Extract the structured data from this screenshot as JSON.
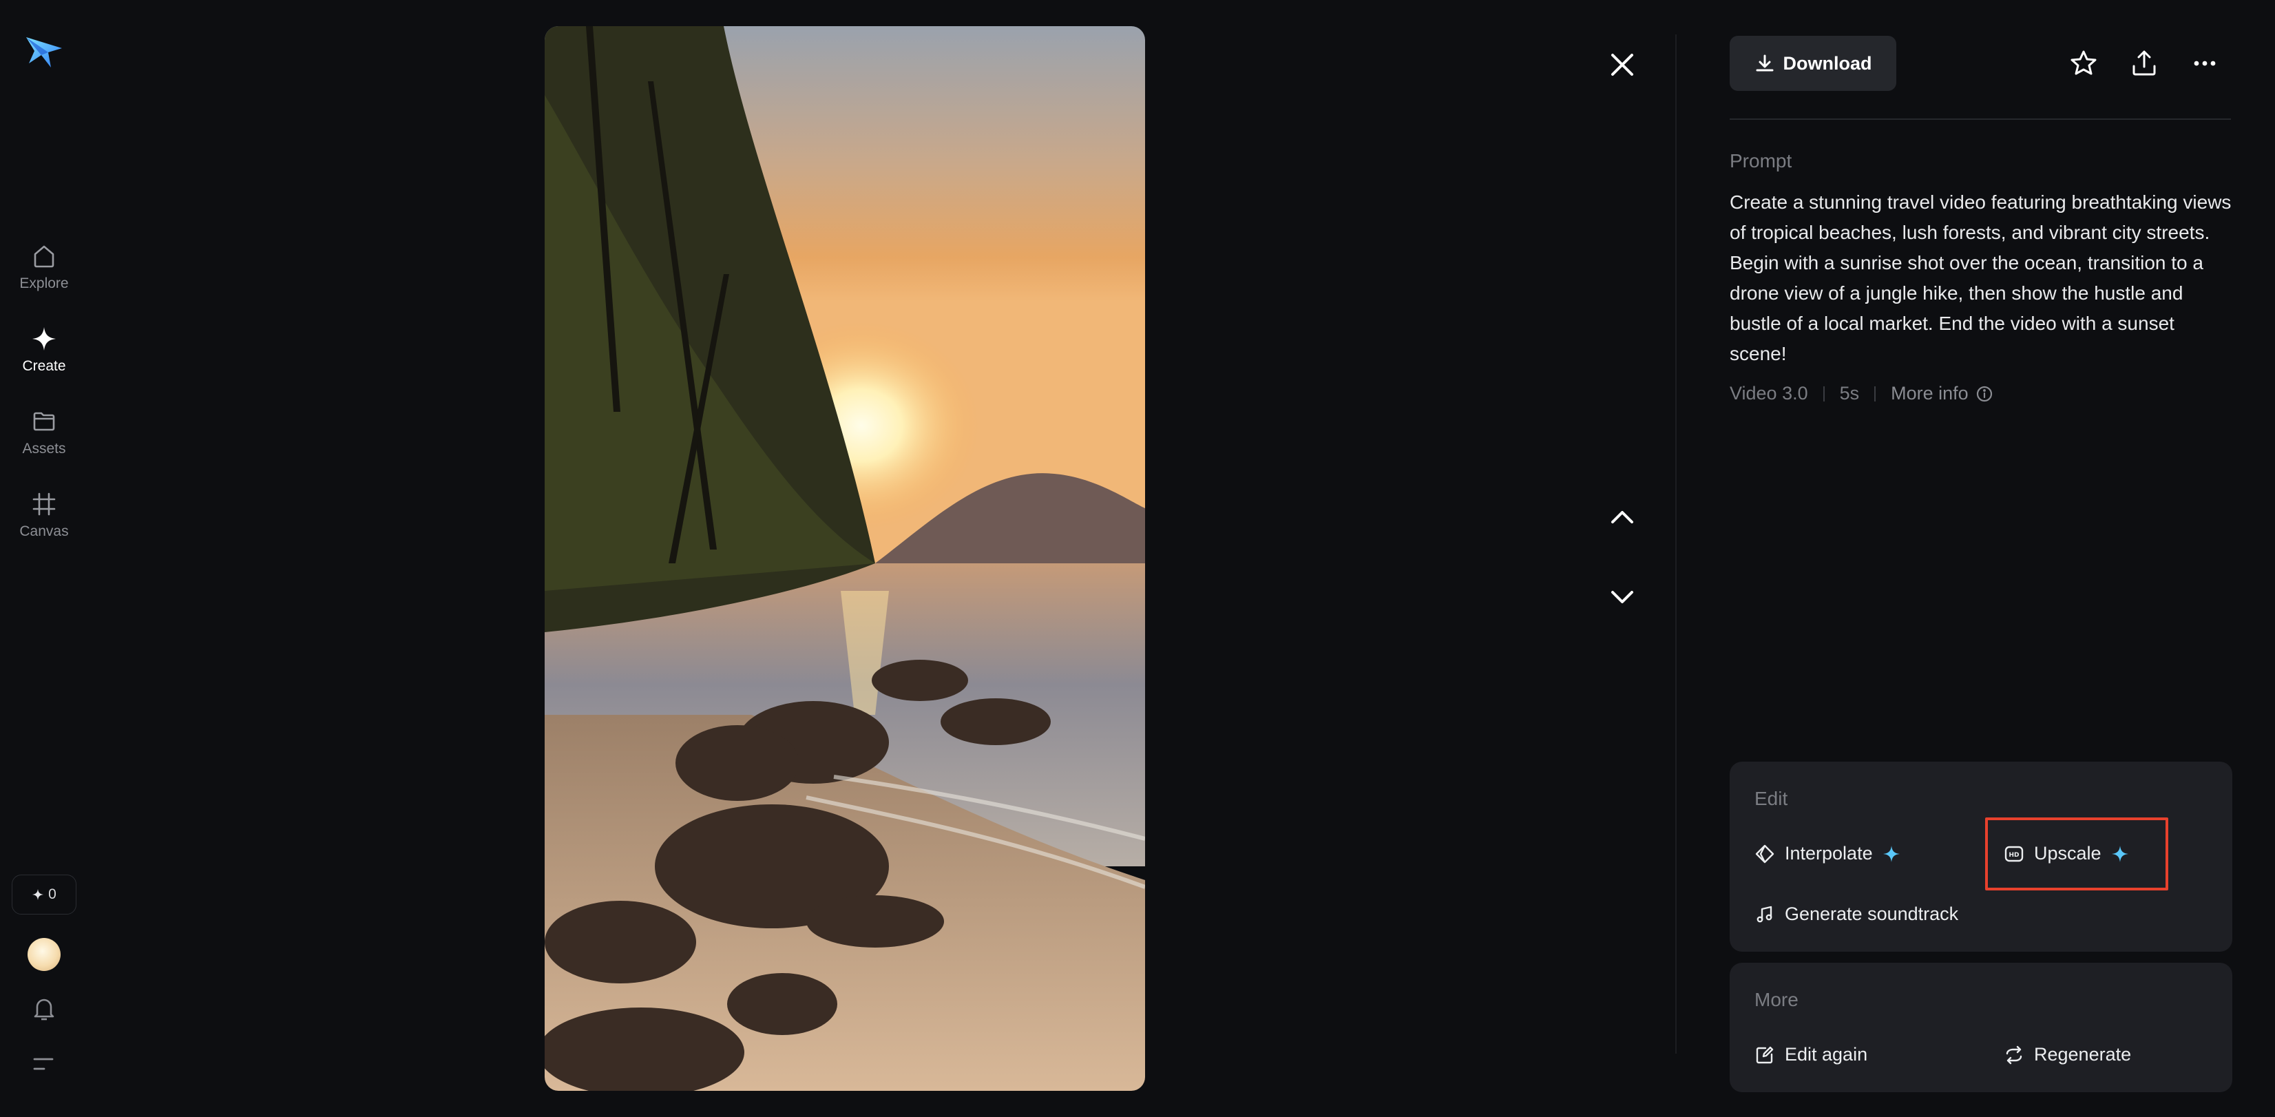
{
  "sidebar": {
    "items": [
      {
        "label": "Explore",
        "icon": "home-icon",
        "active": false
      },
      {
        "label": "Create",
        "icon": "sparkle-icon",
        "active": true
      },
      {
        "label": "Assets",
        "icon": "folder-icon",
        "active": false
      },
      {
        "label": "Canvas",
        "icon": "canvas-icon",
        "active": false
      }
    ],
    "credits": "0",
    "credits_icon": "sparkle-icon"
  },
  "media": {
    "type": "video",
    "description_icon": "beach-sunset-video"
  },
  "toolbar": {
    "download_label": "Download",
    "icons": [
      "star-icon",
      "share-icon",
      "more-icon"
    ]
  },
  "prompt": {
    "label": "Prompt",
    "text": "Create a stunning travel video featuring breathtaking views of tropical beaches, lush forests, and vibrant city streets. Begin with a sunrise shot over the ocean, transition to a drone view of a jungle hike, then show the hustle and bustle of a local market. End the video with a sunset scene!"
  },
  "meta": {
    "model": "Video 3.0",
    "duration": "5s",
    "more_info": "More info"
  },
  "edit": {
    "title": "Edit",
    "interpolate": "Interpolate",
    "upscale": "Upscale",
    "soundtrack": "Generate soundtrack"
  },
  "more": {
    "title": "More",
    "edit_again": "Edit again",
    "regenerate": "Regenerate"
  },
  "colors": {
    "background": "#0d0e11",
    "card": "#1e1f24",
    "accent_sparkle": "#5ac8fa",
    "highlight": "#e8412d"
  }
}
